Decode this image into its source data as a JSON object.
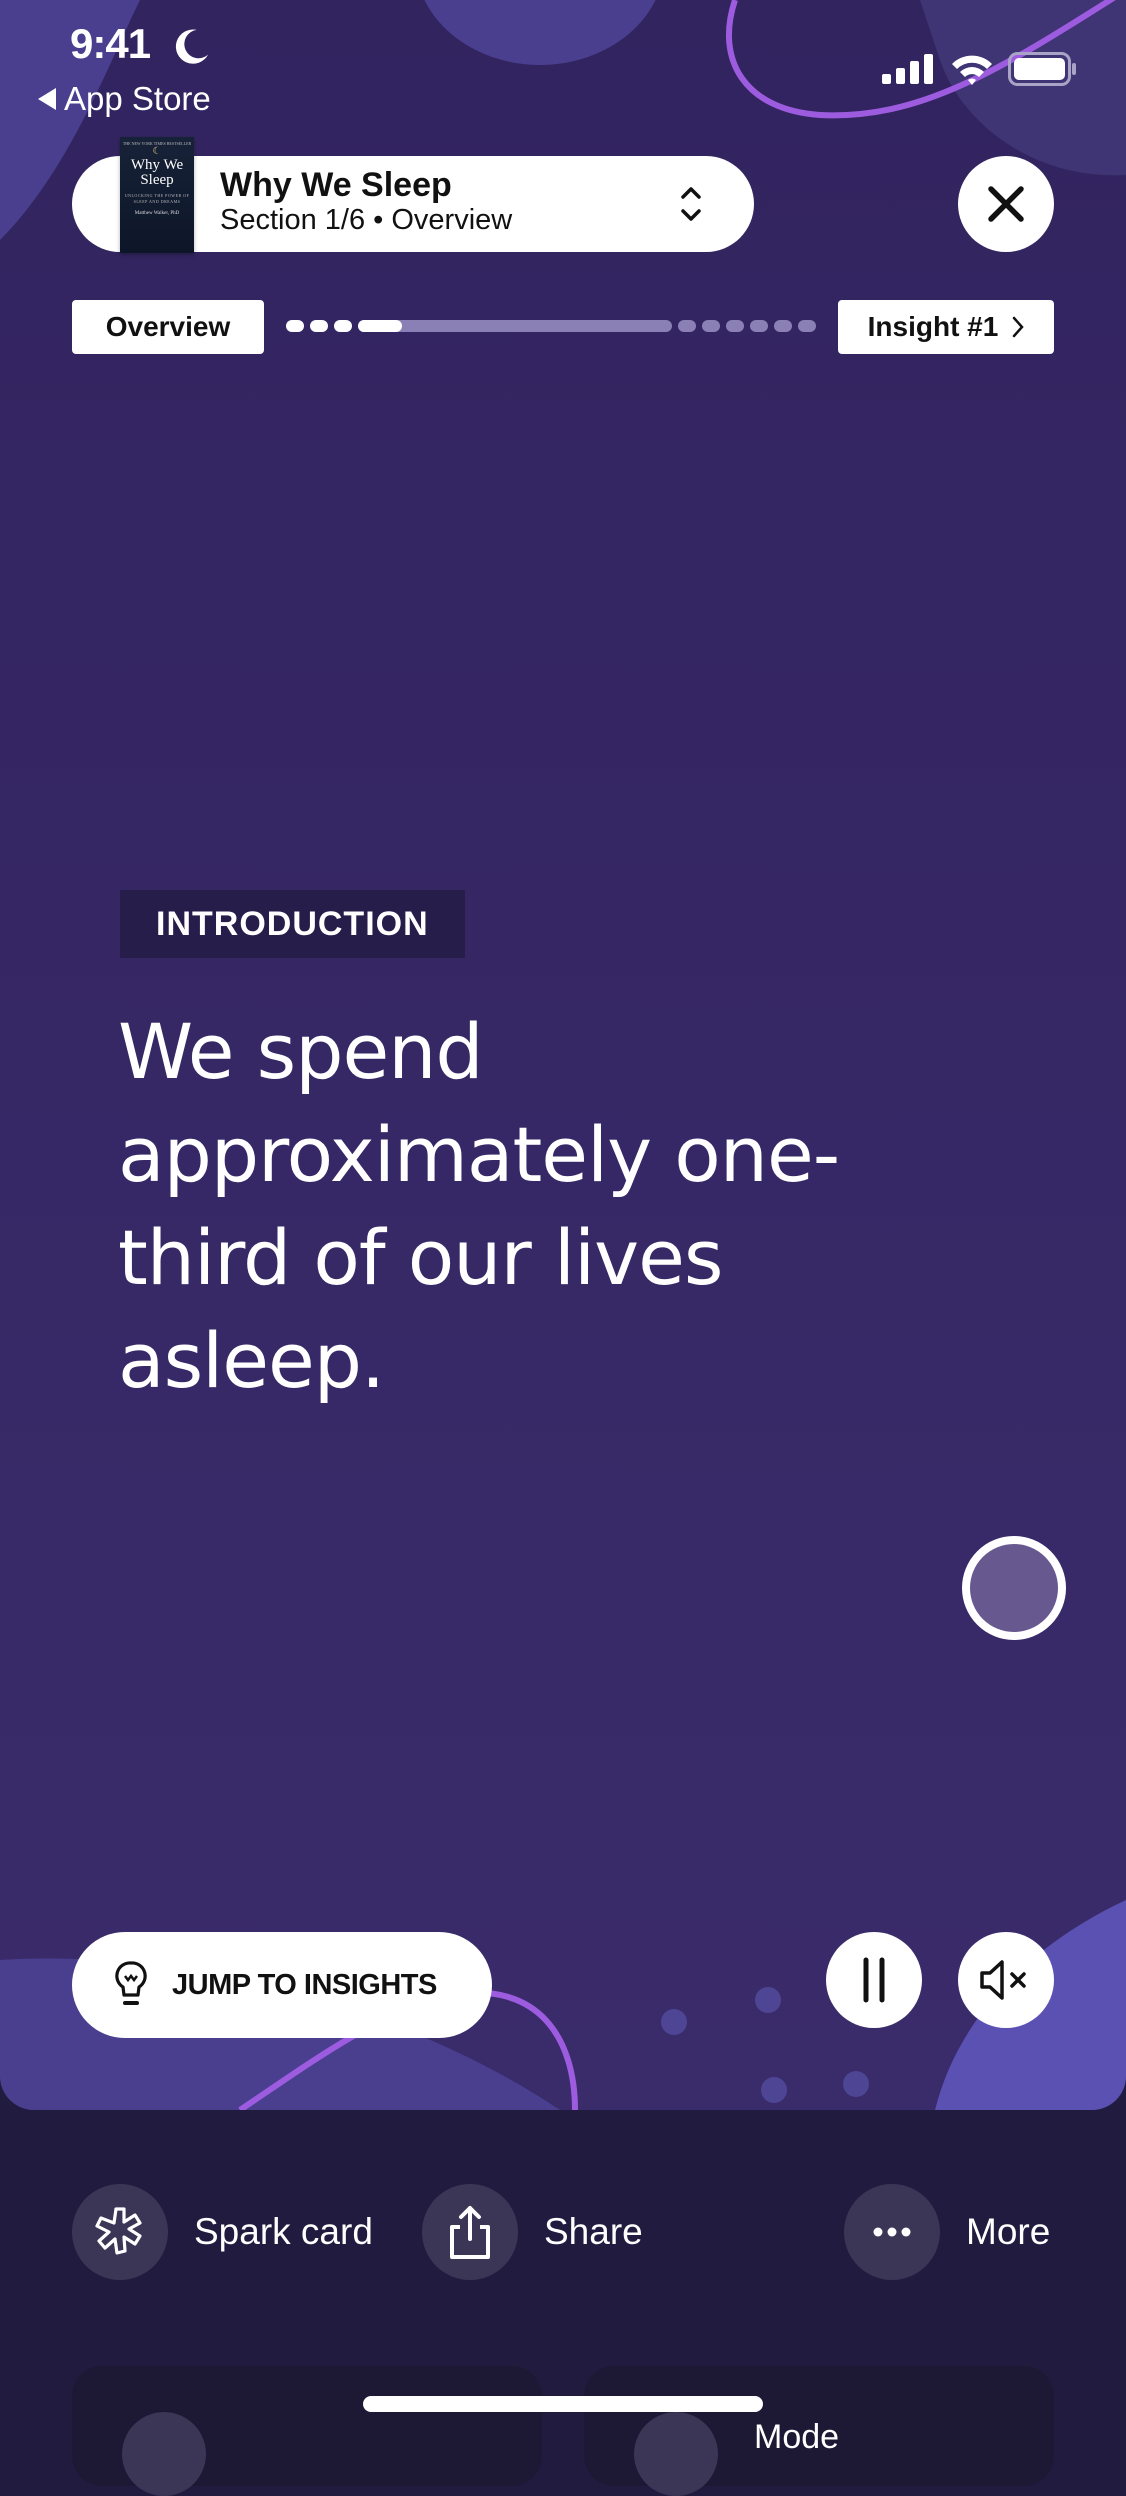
{
  "status_bar": {
    "time": "9:41",
    "focus_icon": "moon-icon",
    "back_label": "App Store",
    "icons": [
      "cellular-signal-icon",
      "wifi-icon",
      "battery-icon"
    ]
  },
  "header": {
    "book_title": "Why We Sleep",
    "section_info": "Section 1/6 • Overview",
    "cover": {
      "top_line": "THE NEW YORK TIMES BESTSELLER",
      "title_line1": "Why We",
      "title_line2": "Sleep",
      "subtitle": "UNLOCKING THE POWER OF SLEEP AND DREAMS",
      "author": "Matthew Walker, PhD"
    },
    "section_picker_icon": "chevron-up-down-icon",
    "close_icon": "close-icon"
  },
  "navigation": {
    "prev_label": "Overview",
    "next_label": "Insight #1",
    "next_icon": "chevron-right-icon",
    "progress": {
      "completed_dots": 3,
      "current_segment_fill": 0.14,
      "remaining_dots": 6
    }
  },
  "content": {
    "section_tag": "INTRODUCTION",
    "headline": "We spend approximately one-third of our lives asleep."
  },
  "controls": {
    "jump_label": "JUMP TO INSIGHTS",
    "jump_icon": "lightbulb-icon",
    "pause_icon": "pause-icon",
    "mute_icon": "speaker-muted-icon",
    "record_icon": "record-icon"
  },
  "actions": [
    {
      "label": "Spark card",
      "icon": "spark-icon"
    },
    {
      "label": "Share",
      "icon": "share-icon"
    },
    {
      "label": "More",
      "icon": "ellipsis-icon"
    }
  ],
  "cards": [
    {
      "label": ""
    },
    {
      "label": "Mode"
    }
  ],
  "colors": {
    "background_top": "#32245f",
    "background_bottom": "#3a2b6b",
    "blob": "#4a3f8f",
    "blob_light": "#5b51b3",
    "accent_line": "#9d5ce0",
    "tag_background": "#261d4a",
    "footer_background": "#211c3f",
    "action_circle": "#3b3556",
    "progress_remaining": "#8b80b5"
  }
}
